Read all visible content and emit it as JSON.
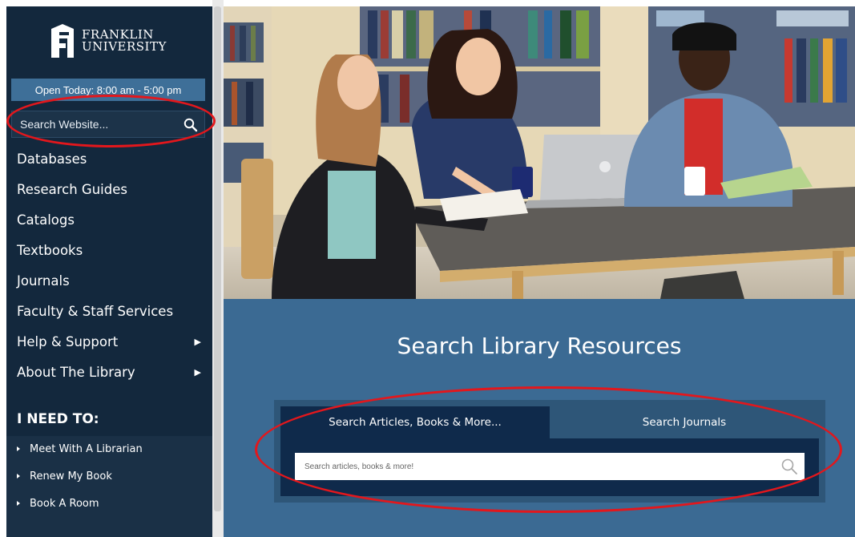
{
  "brand": {
    "line1": "FRANKLIN",
    "line2": "UNIVERSITY"
  },
  "hours": "Open Today: 8:00 am - 5:00 pm",
  "site_search": {
    "placeholder": "Search Website..."
  },
  "nav": [
    {
      "label": "Databases",
      "has_submenu": false
    },
    {
      "label": "Research Guides",
      "has_submenu": false
    },
    {
      "label": "Catalogs",
      "has_submenu": false
    },
    {
      "label": "Textbooks",
      "has_submenu": false
    },
    {
      "label": "Journals",
      "has_submenu": false
    },
    {
      "label": "Faculty & Staff Services",
      "has_submenu": false
    },
    {
      "label": "Help & Support",
      "has_submenu": true,
      "arrow": "▶"
    },
    {
      "label": "About The Library",
      "has_submenu": true,
      "arrow": "▶"
    }
  ],
  "i_need_to": {
    "title": "I NEED TO:",
    "items": [
      "Meet With A Librarian",
      "Renew My Book",
      "Book A Room"
    ]
  },
  "search_section": {
    "title": "Search Library Resources",
    "tabs": [
      {
        "label": "Search Articles, Books & More...",
        "active": true
      },
      {
        "label": "Search Journals",
        "active": false
      }
    ],
    "input": {
      "placeholder": "Search articles, books & more!"
    }
  },
  "colors": {
    "sidebar_bg": "#13283d",
    "hours_bg": "#3e6f98",
    "panel_bg": "#3b6a93",
    "tab_active": "#0f2a4b",
    "annotation_red": "#e3171c"
  },
  "icons": [
    "franklin-logo-icon",
    "search-icon",
    "magnifier-icon",
    "triangle-right-icon",
    "bullet-icon"
  ]
}
